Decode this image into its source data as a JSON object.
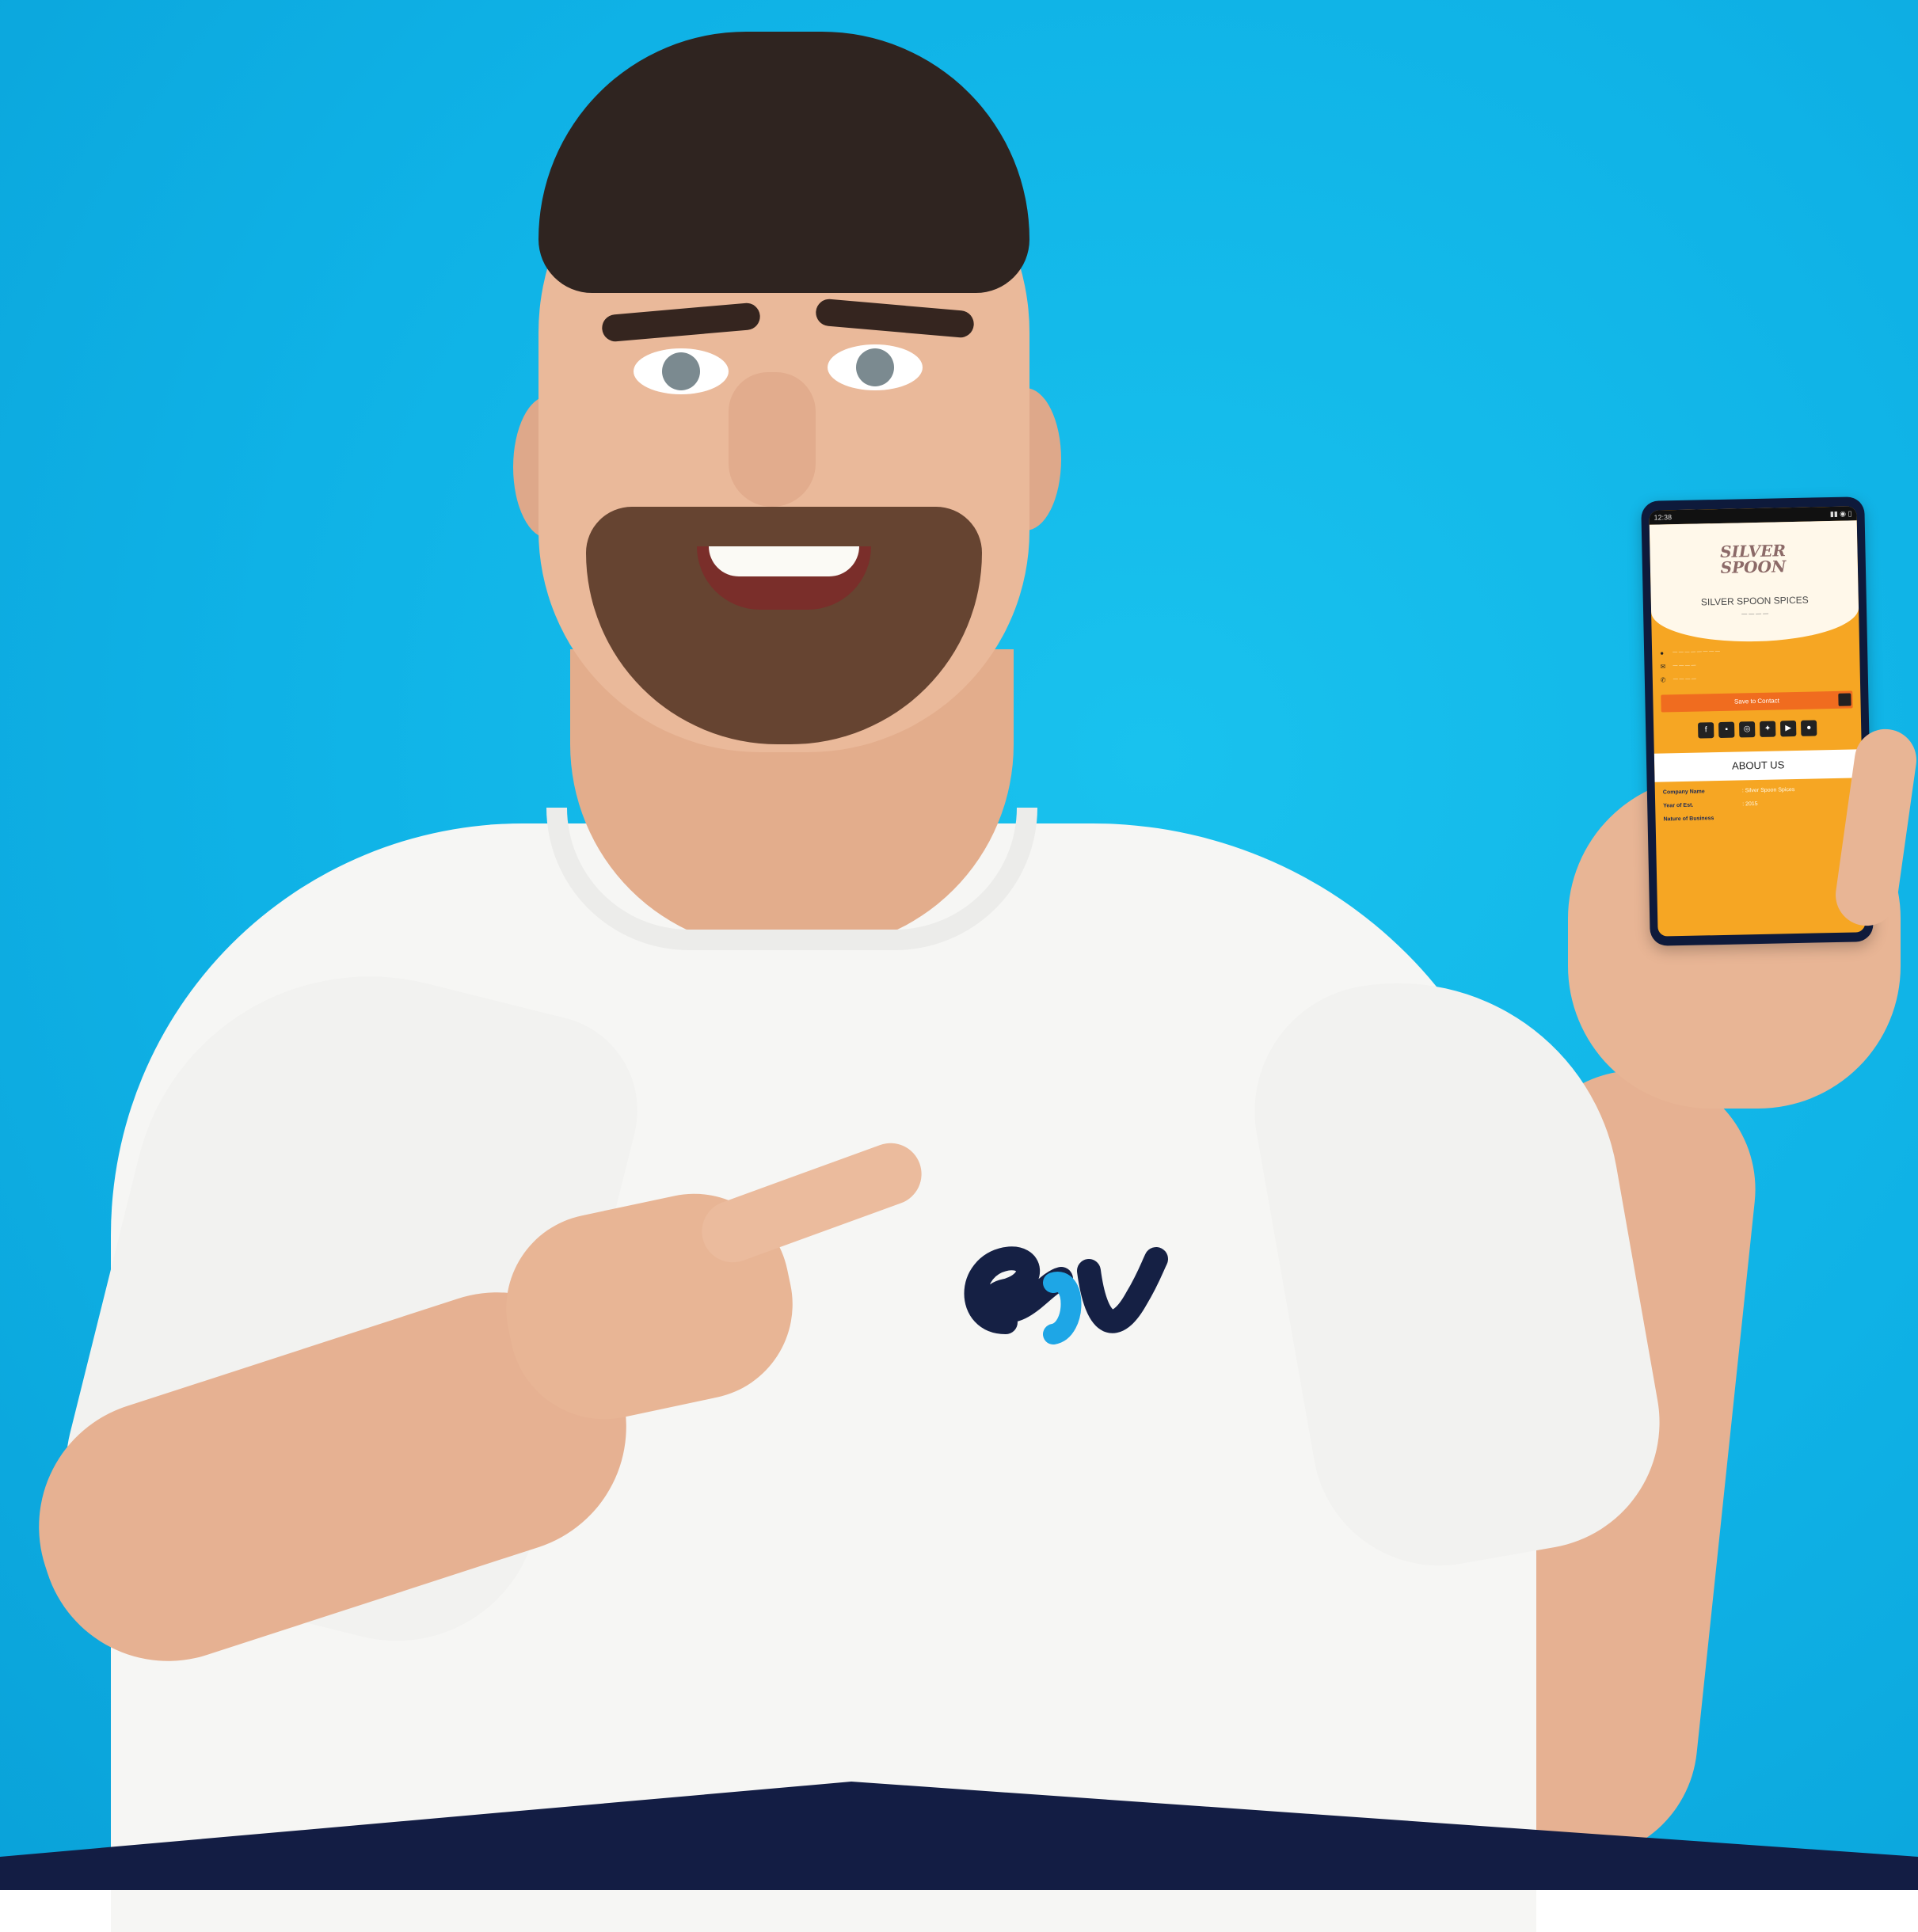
{
  "phone": {
    "status_time": "12:38",
    "brand_line1": "SILVER",
    "brand_line2": "SPOON",
    "company_title": "SILVER SPOON SPICES",
    "save_button_label": "Save to Contact",
    "about_title": "ABOUT US",
    "about_rows": [
      {
        "key": "Company Name",
        "value": ": Silver Spoon Spices"
      },
      {
        "key": "Year of Est.",
        "value": ": 2015"
      },
      {
        "key": "Nature of Business",
        "value": ""
      }
    ],
    "social_icons": [
      "facebook-icon",
      "linkedin-icon",
      "instagram-icon",
      "twitter-icon",
      "youtube-icon",
      "pinterest-icon"
    ]
  },
  "colors": {
    "background": "#0fb2e6",
    "shirt": "#f6f6f4",
    "phone_accent": "#f6a623",
    "logo_navy": "#152044",
    "logo_blue": "#1ea6e6",
    "band": "#131d44"
  }
}
